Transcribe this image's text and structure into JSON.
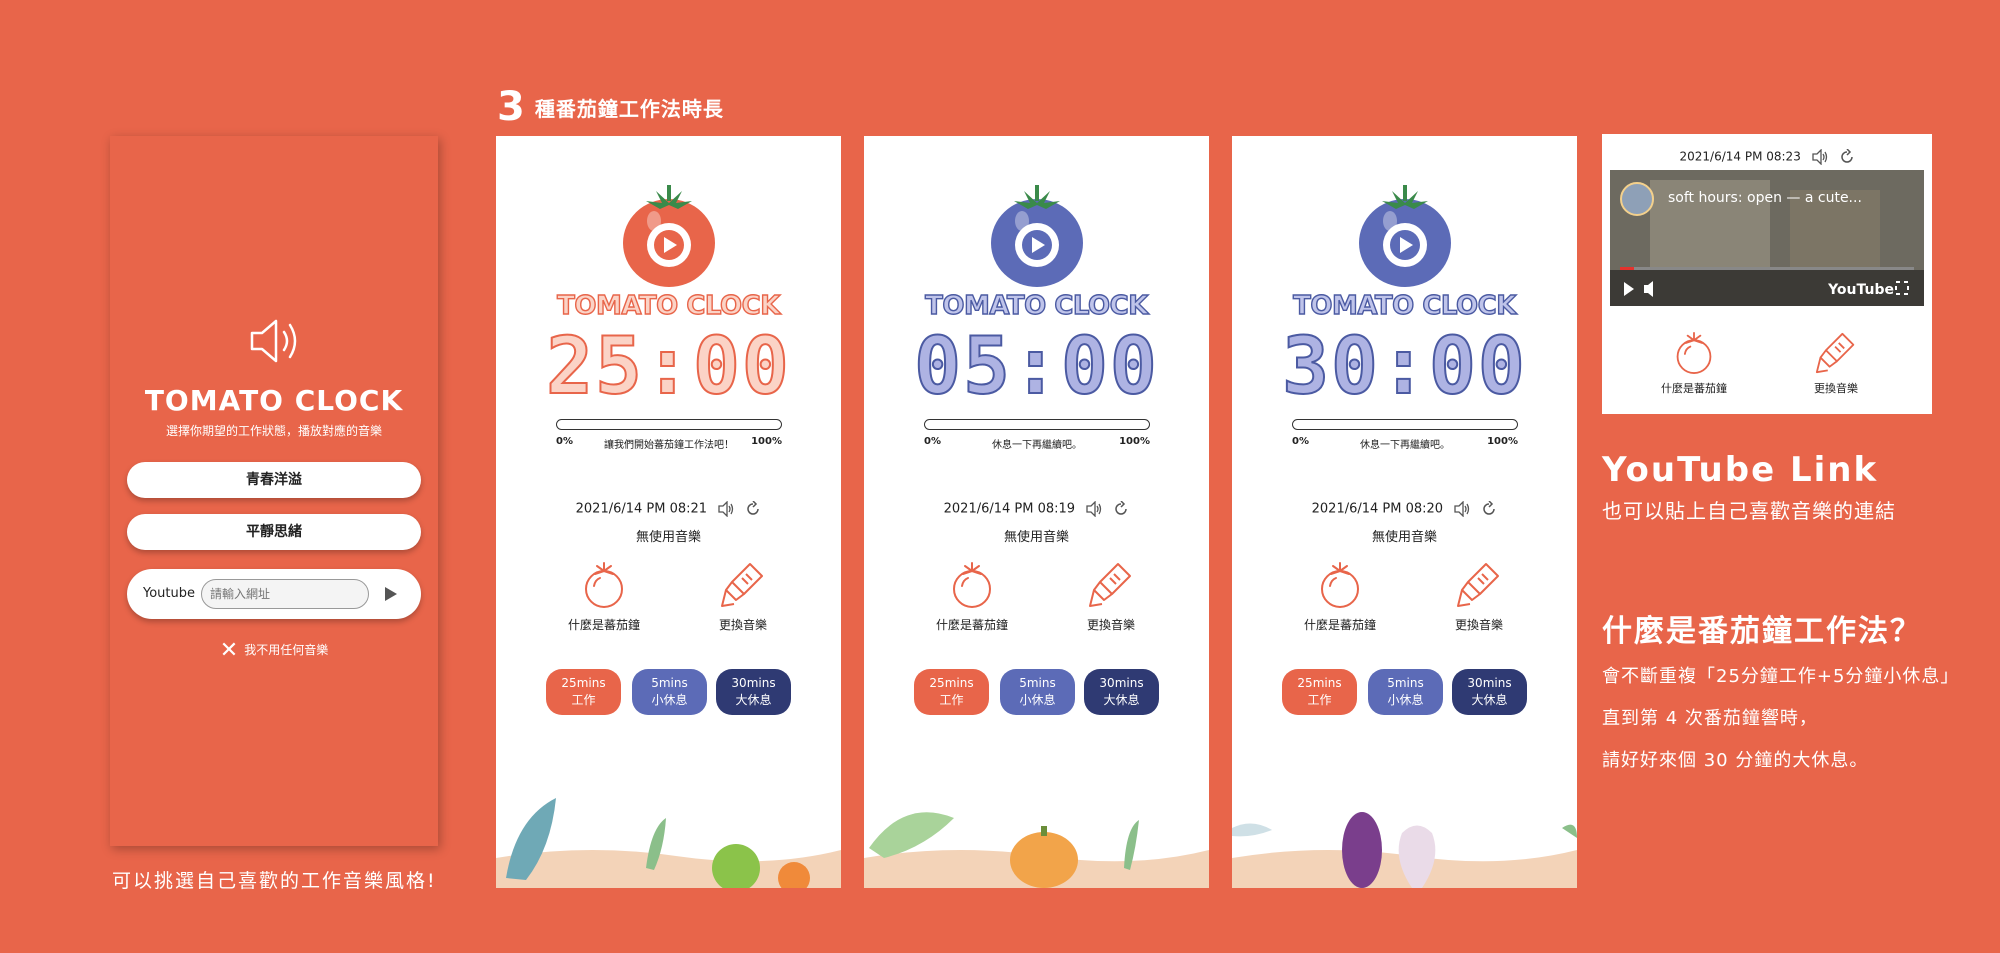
{
  "menu": {
    "title": "TOMATO CLOCK",
    "subtitle": "選擇你期望的工作狀態，播放對應的音樂",
    "options": [
      "青春洋溢",
      "平靜思緒"
    ],
    "youtube_label": "Youtube",
    "youtube_placeholder": "請輸入網址",
    "no_music": "我不用任何音樂",
    "caption": "可以挑選自己喜歡的工作音樂風格!"
  },
  "section": {
    "number": "3",
    "title": "種番茄鐘工作法時長"
  },
  "screens": [
    {
      "title": "TOMATO CLOCK",
      "timer": "25:00",
      "progress_min": "0%",
      "progress_msg": "讓我們開始蕃茄鐘工作法吧！",
      "progress_max": "100%",
      "progress_value": 0,
      "datetime": "2021/6/14 PM 08:21",
      "music_status": "無使用音樂",
      "action1": "什麼是蕃茄鐘",
      "action2": "更換音樂",
      "tomato_color": "#e8654a"
    },
    {
      "title": "TOMATO CLOCK",
      "timer": "05:00",
      "progress_min": "0%",
      "progress_msg": "休息一下再繼續吧。",
      "progress_max": "100%",
      "progress_value": 0,
      "datetime": "2021/6/14 PM 08:19",
      "music_status": "無使用音樂",
      "action1": "什麼是蕃茄鐘",
      "action2": "更換音樂",
      "tomato_color": "#5c6bb7"
    },
    {
      "title": "TOMATO CLOCK",
      "timer": "30:00",
      "progress_min": "0%",
      "progress_msg": "休息一下再繼續吧。",
      "progress_max": "100%",
      "progress_value": 0,
      "datetime": "2021/6/14 PM 08:20",
      "music_status": "無使用音樂",
      "action1": "什麼是蕃茄鐘",
      "action2": "更換音樂",
      "tomato_color": "#5c6bb7"
    }
  ],
  "modes": [
    {
      "time": "25mins",
      "label": "工作",
      "color": "#e8654a"
    },
    {
      "time": "5mins",
      "label": "小休息",
      "color": "#5c6bb7"
    },
    {
      "time": "30mins",
      "label": "大休息",
      "color": "#2f3a73"
    }
  ],
  "youtube_card": {
    "datetime": "2021/6/14 PM 08:23",
    "video_title": "soft hours: open — a cute...",
    "brand": "YouTube",
    "action1": "什麼是蕃茄鐘",
    "action2": "更換音樂"
  },
  "youtube_info": {
    "heading": "YouTube Link",
    "subheading": "也可以貼上自己喜歡音樂的連結"
  },
  "what_is": {
    "title": "什麼是番茄鐘工作法？",
    "lines": [
      "會不斷重複「25分鐘工作+5分鐘小休息」",
      "直到第 4 次番茄鐘響時，",
      "請好好來個 30 分鐘的大休息。"
    ]
  },
  "colors": {
    "background": "#e8654a",
    "tomato_red": "#e8654a",
    "blue": "#5c6bb7",
    "navy": "#2f3a73",
    "leaf": "#3a8a4a"
  }
}
